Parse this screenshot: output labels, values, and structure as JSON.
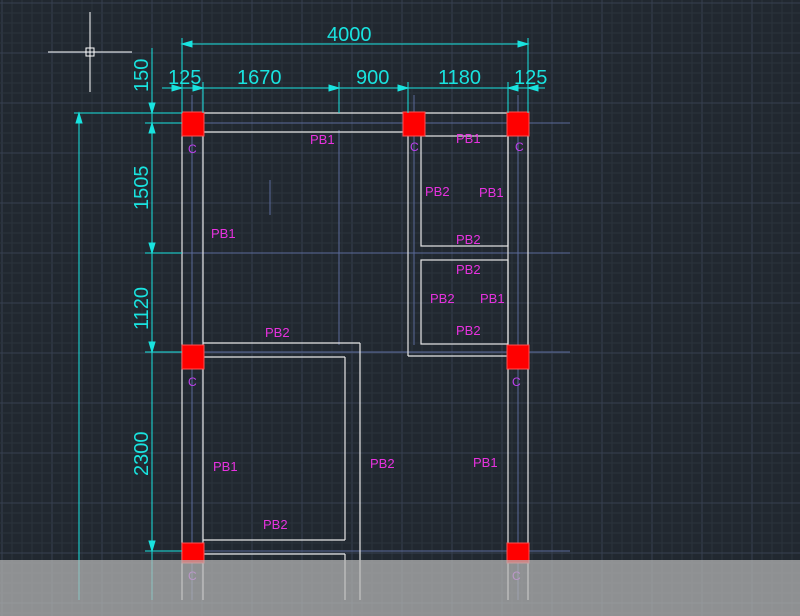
{
  "colors": {
    "background": "#212830",
    "grid_minor": "#2b333c",
    "grid_major": "#364050",
    "dimension": "#19e3df",
    "beam_outline": "#e6e6e6",
    "column_fill": "#ff0000",
    "label": "#e832e0",
    "axis_line": "#5a6a9a"
  },
  "dimensions": {
    "overall_width": "4000",
    "spans": [
      "125",
      "1670",
      "900",
      "1180",
      "125"
    ],
    "heights": [
      "150",
      "1505",
      "1120",
      "2300"
    ]
  },
  "columns": {
    "label": "C"
  },
  "beams": {
    "pb1": "PB1",
    "pb2": "PB2"
  },
  "cursor": {
    "icon": "crosshair-cursor-icon"
  }
}
